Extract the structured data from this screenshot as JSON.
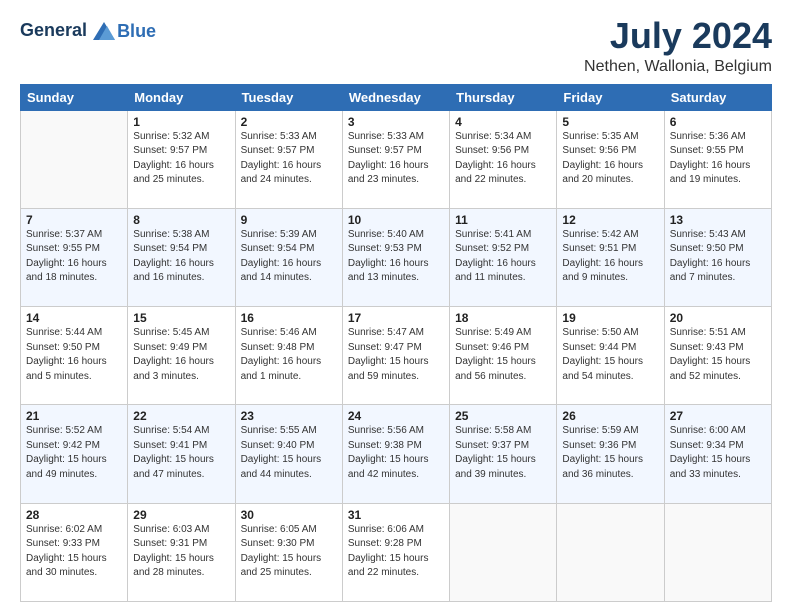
{
  "header": {
    "logo_line1": "General",
    "logo_line2": "Blue",
    "title": "July 2024",
    "subtitle": "Nethen, Wallonia, Belgium"
  },
  "columns": [
    "Sunday",
    "Monday",
    "Tuesday",
    "Wednesday",
    "Thursday",
    "Friday",
    "Saturday"
  ],
  "weeks": [
    [
      {
        "num": "",
        "info": ""
      },
      {
        "num": "1",
        "info": "Sunrise: 5:32 AM\nSunset: 9:57 PM\nDaylight: 16 hours\nand 25 minutes."
      },
      {
        "num": "2",
        "info": "Sunrise: 5:33 AM\nSunset: 9:57 PM\nDaylight: 16 hours\nand 24 minutes."
      },
      {
        "num": "3",
        "info": "Sunrise: 5:33 AM\nSunset: 9:57 PM\nDaylight: 16 hours\nand 23 minutes."
      },
      {
        "num": "4",
        "info": "Sunrise: 5:34 AM\nSunset: 9:56 PM\nDaylight: 16 hours\nand 22 minutes."
      },
      {
        "num": "5",
        "info": "Sunrise: 5:35 AM\nSunset: 9:56 PM\nDaylight: 16 hours\nand 20 minutes."
      },
      {
        "num": "6",
        "info": "Sunrise: 5:36 AM\nSunset: 9:55 PM\nDaylight: 16 hours\nand 19 minutes."
      }
    ],
    [
      {
        "num": "7",
        "info": "Sunrise: 5:37 AM\nSunset: 9:55 PM\nDaylight: 16 hours\nand 18 minutes."
      },
      {
        "num": "8",
        "info": "Sunrise: 5:38 AM\nSunset: 9:54 PM\nDaylight: 16 hours\nand 16 minutes."
      },
      {
        "num": "9",
        "info": "Sunrise: 5:39 AM\nSunset: 9:54 PM\nDaylight: 16 hours\nand 14 minutes."
      },
      {
        "num": "10",
        "info": "Sunrise: 5:40 AM\nSunset: 9:53 PM\nDaylight: 16 hours\nand 13 minutes."
      },
      {
        "num": "11",
        "info": "Sunrise: 5:41 AM\nSunset: 9:52 PM\nDaylight: 16 hours\nand 11 minutes."
      },
      {
        "num": "12",
        "info": "Sunrise: 5:42 AM\nSunset: 9:51 PM\nDaylight: 16 hours\nand 9 minutes."
      },
      {
        "num": "13",
        "info": "Sunrise: 5:43 AM\nSunset: 9:50 PM\nDaylight: 16 hours\nand 7 minutes."
      }
    ],
    [
      {
        "num": "14",
        "info": "Sunrise: 5:44 AM\nSunset: 9:50 PM\nDaylight: 16 hours\nand 5 minutes."
      },
      {
        "num": "15",
        "info": "Sunrise: 5:45 AM\nSunset: 9:49 PM\nDaylight: 16 hours\nand 3 minutes."
      },
      {
        "num": "16",
        "info": "Sunrise: 5:46 AM\nSunset: 9:48 PM\nDaylight: 16 hours\nand 1 minute."
      },
      {
        "num": "17",
        "info": "Sunrise: 5:47 AM\nSunset: 9:47 PM\nDaylight: 15 hours\nand 59 minutes."
      },
      {
        "num": "18",
        "info": "Sunrise: 5:49 AM\nSunset: 9:46 PM\nDaylight: 15 hours\nand 56 minutes."
      },
      {
        "num": "19",
        "info": "Sunrise: 5:50 AM\nSunset: 9:44 PM\nDaylight: 15 hours\nand 54 minutes."
      },
      {
        "num": "20",
        "info": "Sunrise: 5:51 AM\nSunset: 9:43 PM\nDaylight: 15 hours\nand 52 minutes."
      }
    ],
    [
      {
        "num": "21",
        "info": "Sunrise: 5:52 AM\nSunset: 9:42 PM\nDaylight: 15 hours\nand 49 minutes."
      },
      {
        "num": "22",
        "info": "Sunrise: 5:54 AM\nSunset: 9:41 PM\nDaylight: 15 hours\nand 47 minutes."
      },
      {
        "num": "23",
        "info": "Sunrise: 5:55 AM\nSunset: 9:40 PM\nDaylight: 15 hours\nand 44 minutes."
      },
      {
        "num": "24",
        "info": "Sunrise: 5:56 AM\nSunset: 9:38 PM\nDaylight: 15 hours\nand 42 minutes."
      },
      {
        "num": "25",
        "info": "Sunrise: 5:58 AM\nSunset: 9:37 PM\nDaylight: 15 hours\nand 39 minutes."
      },
      {
        "num": "26",
        "info": "Sunrise: 5:59 AM\nSunset: 9:36 PM\nDaylight: 15 hours\nand 36 minutes."
      },
      {
        "num": "27",
        "info": "Sunrise: 6:00 AM\nSunset: 9:34 PM\nDaylight: 15 hours\nand 33 minutes."
      }
    ],
    [
      {
        "num": "28",
        "info": "Sunrise: 6:02 AM\nSunset: 9:33 PM\nDaylight: 15 hours\nand 30 minutes."
      },
      {
        "num": "29",
        "info": "Sunrise: 6:03 AM\nSunset: 9:31 PM\nDaylight: 15 hours\nand 28 minutes."
      },
      {
        "num": "30",
        "info": "Sunrise: 6:05 AM\nSunset: 9:30 PM\nDaylight: 15 hours\nand 25 minutes."
      },
      {
        "num": "31",
        "info": "Sunrise: 6:06 AM\nSunset: 9:28 PM\nDaylight: 15 hours\nand 22 minutes."
      },
      {
        "num": "",
        "info": ""
      },
      {
        "num": "",
        "info": ""
      },
      {
        "num": "",
        "info": ""
      }
    ]
  ]
}
